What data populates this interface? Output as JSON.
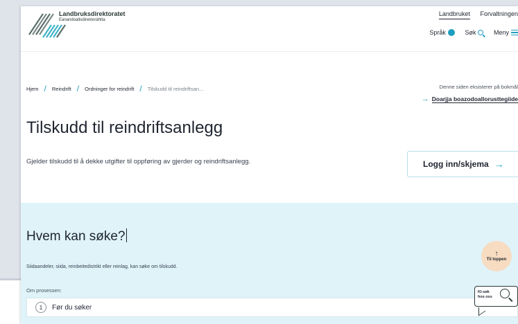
{
  "header": {
    "org_name": "Landbruksdirektoratet",
    "org_sub": "Eanandoallodirektoráhtta",
    "top_links": [
      "Landbruket",
      "Forvaltningen"
    ],
    "actions": {
      "language": "Språk",
      "search": "Søk",
      "menu": "Meny"
    }
  },
  "breadcrumb": [
    "Hjem",
    "Reindrift",
    "Ordninger for reindrift",
    "Tilskudd til reindriftsan..."
  ],
  "language_notice": {
    "note": "Denne siden eksisterer på bokmål",
    "link": "Doarjja boazodoallorusttegiide"
  },
  "page": {
    "title": "Tilskudd til reindriftsanlegg",
    "lead": "Gjelder tilskudd til å dekke utgifter til oppføring av gjerder og reindriftsanlegg.",
    "login_button": "Logg inn/skjema"
  },
  "section": {
    "heading": "Hvem kan søke?",
    "description": "Siidaandeler, siida, reinbeitedistrikt eller reinlag, kan søke om tilskudd.",
    "process_label": "Om prosessen:",
    "steps": [
      {
        "number": "1",
        "label": "Før du søker"
      }
    ]
  },
  "floating": {
    "to_top": "Til toppen",
    "ki_search_line1": "KI-søk",
    "ki_search_line2": "hos oss"
  },
  "colors": {
    "accent": "#1e9ec0",
    "section_bg": "#dff3f9",
    "to_top_bg": "#f7dcc1"
  },
  "icons": [
    "logo",
    "globe-icon",
    "search-icon",
    "menu-icon",
    "arrow-right-icon",
    "arrow-up-icon",
    "ki-search-icon"
  ]
}
